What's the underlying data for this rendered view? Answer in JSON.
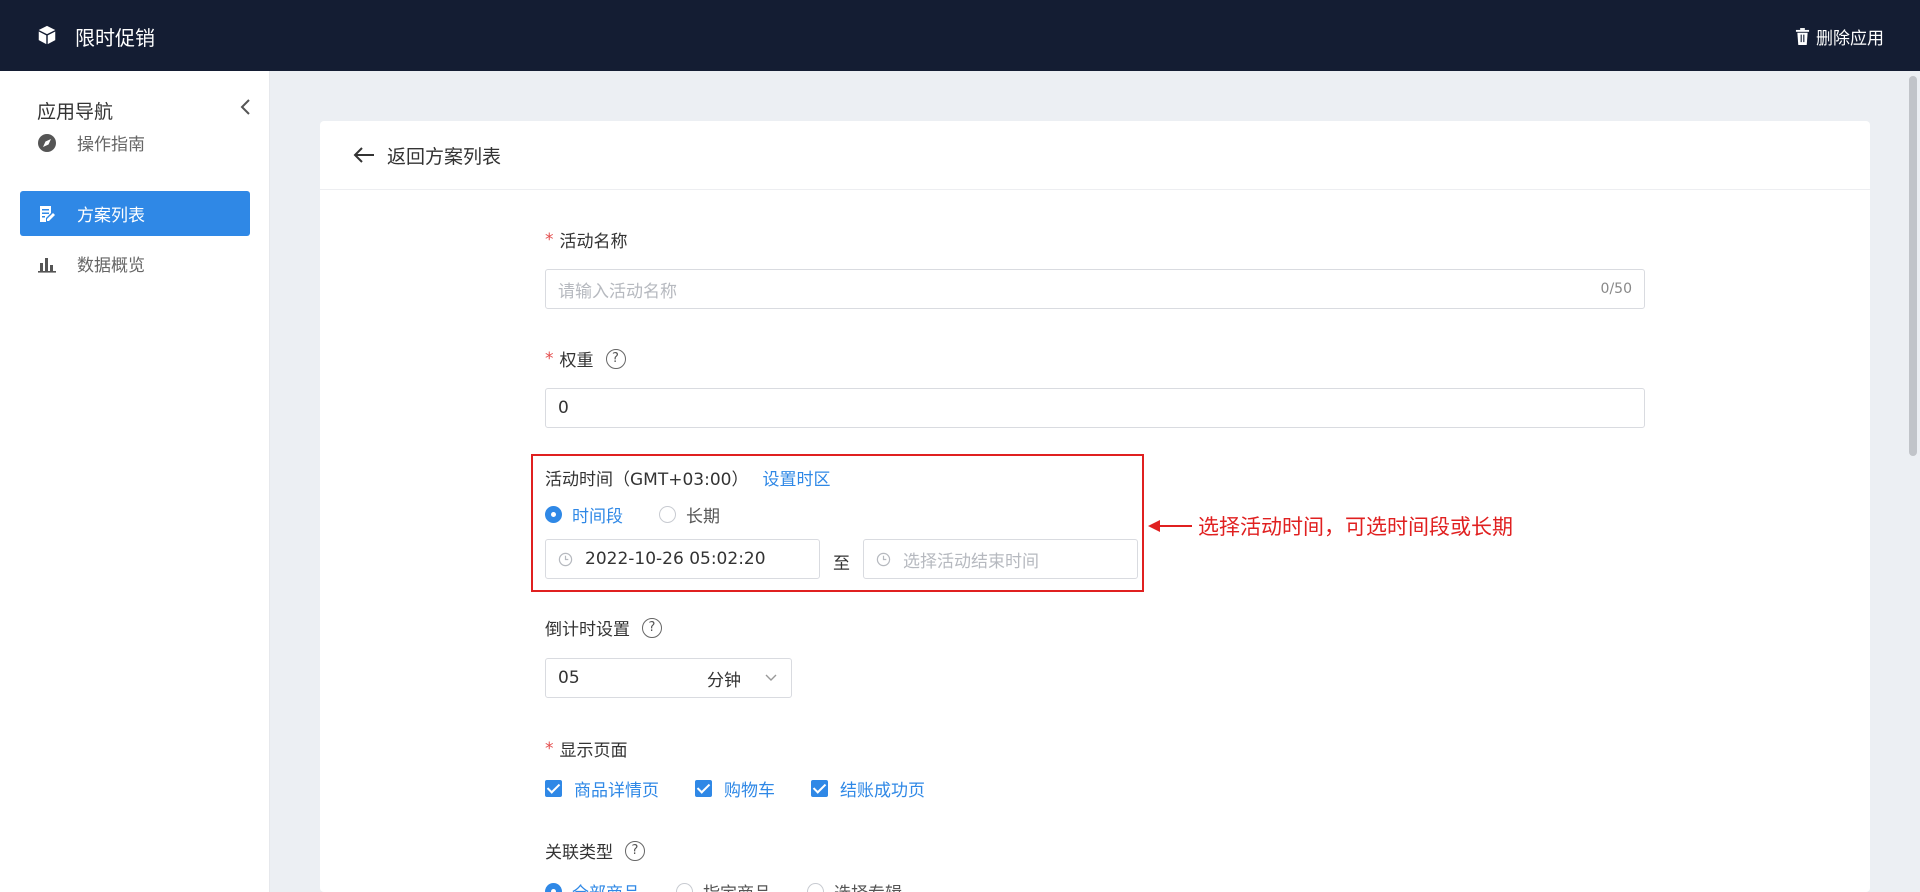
{
  "topbar": {
    "app_title": "限时促销",
    "delete_label": "删除应用",
    "background": "#141d33"
  },
  "sidebar": {
    "title": "应用导航",
    "items": [
      {
        "label": "操作指南",
        "icon": "compass-icon",
        "active": false
      },
      {
        "label": "方案列表",
        "icon": "document-edit-icon",
        "active": true
      },
      {
        "label": "数据概览",
        "icon": "bar-chart-icon",
        "active": false
      }
    ]
  },
  "header": {
    "back_label": "返回方案列表"
  },
  "form": {
    "activity_name": {
      "label": "活动名称",
      "placeholder": "请输入活动名称",
      "counter": "0/50"
    },
    "weight": {
      "label": "权重",
      "value": "0"
    },
    "activity_time": {
      "label": "活动时间（GMT+03:00）",
      "set_timezone_link": "设置时区",
      "options": [
        "时间段",
        "长期"
      ],
      "selected": "时间段",
      "start_value": "2022-10-26 05:02:20",
      "separator": "至",
      "end_placeholder": "选择活动结束时间"
    },
    "countdown": {
      "label": "倒计时设置",
      "value": "05",
      "unit": "分钟"
    },
    "display_pages": {
      "label": "显示页面",
      "options": [
        "商品详情页",
        "购物车",
        "结账成功页"
      ]
    },
    "relation_type": {
      "label": "关联类型",
      "options": [
        "全部商品",
        "指定商品",
        "选择专辑"
      ],
      "selected": "全部商品"
    }
  },
  "annotation": {
    "text": "选择活动时间，可选时间段或长期",
    "color": "#e02020"
  },
  "colors": {
    "accent": "#2f88e6",
    "required": "#e34d4d"
  }
}
